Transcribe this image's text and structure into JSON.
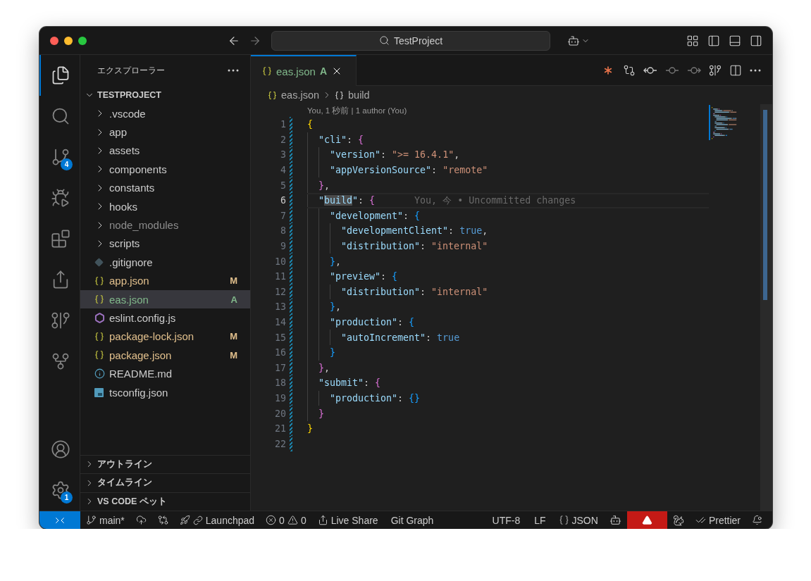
{
  "title_bar": {
    "search": "TestProject"
  },
  "activity_bar": {
    "top": [
      {
        "kind": "files",
        "selected": true
      },
      {
        "kind": "search",
        "selected": false
      },
      {
        "kind": "source-control",
        "selected": false,
        "badge": "4"
      },
      {
        "kind": "run-debug",
        "selected": false
      },
      {
        "kind": "extensions",
        "selected": false
      },
      {
        "kind": "live-share",
        "selected": false
      },
      {
        "kind": "git-graph",
        "selected": false
      },
      {
        "kind": "git-remote",
        "selected": false
      }
    ],
    "bottom": [
      {
        "kind": "account",
        "selected": false
      },
      {
        "kind": "settings",
        "selected": false,
        "badge": "1"
      }
    ]
  },
  "sidebar": {
    "title": "エクスプローラー",
    "root": {
      "label": "TESTPROJECT",
      "expanded": true
    },
    "items": [
      {
        "kind": "folder",
        "label": ".vscode",
        "expanded": false,
        "selected": false,
        "color": "#cccccc"
      },
      {
        "kind": "folder",
        "label": "app",
        "expanded": false,
        "selected": false,
        "color": "#cccccc"
      },
      {
        "kind": "folder",
        "label": "assets",
        "expanded": false,
        "selected": false,
        "color": "#cccccc"
      },
      {
        "kind": "folder",
        "label": "components",
        "expanded": false,
        "selected": false,
        "color": "#cccccc"
      },
      {
        "kind": "folder",
        "label": "constants",
        "expanded": false,
        "selected": false,
        "color": "#cccccc"
      },
      {
        "kind": "folder",
        "label": "hooks",
        "expanded": false,
        "selected": false,
        "color": "#cccccc"
      },
      {
        "kind": "folder",
        "label": "node_modules",
        "expanded": false,
        "selected": false,
        "color": "#8c8c8c"
      },
      {
        "kind": "folder",
        "label": "scripts",
        "expanded": false,
        "selected": false,
        "color": "#cccccc"
      },
      {
        "kind": "git",
        "label": ".gitignore",
        "selected": false,
        "color": "#cccccc"
      },
      {
        "kind": "json",
        "label": "app.json",
        "selected": false,
        "color": "#e2c08d",
        "badge": "M"
      },
      {
        "kind": "json",
        "label": "eas.json",
        "selected": true,
        "color": "#81b88b",
        "badge": "A"
      },
      {
        "kind": "eslint",
        "label": "eslint.config.js",
        "selected": false,
        "color": "#cccccc"
      },
      {
        "kind": "json",
        "label": "package-lock.json",
        "selected": false,
        "color": "#e2c08d",
        "badge": "M"
      },
      {
        "kind": "json",
        "label": "package.json",
        "selected": false,
        "color": "#e2c08d",
        "badge": "M"
      },
      {
        "kind": "info",
        "label": "README.md",
        "selected": false,
        "color": "#cccccc"
      },
      {
        "kind": "ts",
        "label": "tsconfig.json",
        "selected": false,
        "color": "#cccccc"
      }
    ],
    "sections": [
      {
        "label": "アウトライン",
        "expanded": false
      },
      {
        "label": "タイムライン",
        "expanded": false
      },
      {
        "label": "VS CODE ペット",
        "expanded": false
      }
    ]
  },
  "editor": {
    "tabs": [
      {
        "label": "eas.json",
        "status": "A",
        "selected": true
      }
    ],
    "breadcrumb": [
      "eas.json",
      "build"
    ],
    "codelens": "You, 1 秒前 | 1 author (You)",
    "lines": [
      {
        "number": "1",
        "added": true,
        "current": false,
        "tokens": [
          {
            "kind": "b1",
            "text": "{"
          }
        ]
      },
      {
        "number": "2",
        "added": true,
        "current": false,
        "tokens": [
          {
            "kind": "key",
            "text": "  \"cli\""
          },
          {
            "kind": "punct",
            "text": ": "
          },
          {
            "kind": "b2",
            "text": "{"
          }
        ]
      },
      {
        "number": "3",
        "added": true,
        "current": false,
        "tokens": [
          {
            "kind": "key",
            "text": "    \"version\""
          },
          {
            "kind": "punct",
            "text": ": "
          },
          {
            "kind": "str",
            "text": "\">= 16.4.1\""
          },
          {
            "kind": "punct",
            "text": ","
          }
        ]
      },
      {
        "number": "4",
        "added": true,
        "current": false,
        "tokens": [
          {
            "kind": "key",
            "text": "    \"appVersionSource\""
          },
          {
            "kind": "punct",
            "text": ": "
          },
          {
            "kind": "str",
            "text": "\"remote\""
          }
        ]
      },
      {
        "number": "5",
        "added": true,
        "current": false,
        "tokens": [
          {
            "kind": "b2",
            "text": "  }"
          },
          {
            "kind": "punct",
            "text": ","
          }
        ]
      },
      {
        "number": "6",
        "added": true,
        "current": true,
        "blame": "You, 今 • Uncommitted changes",
        "tokens": [
          {
            "kind": "key",
            "text": "  \""
          },
          {
            "kind": "key_match",
            "text": "build"
          },
          {
            "kind": "key",
            "text": "\""
          },
          {
            "kind": "punct",
            "text": ": "
          },
          {
            "kind": "b2",
            "text": "{"
          }
        ]
      },
      {
        "number": "7",
        "added": true,
        "current": false,
        "tokens": [
          {
            "kind": "key",
            "text": "    \"development\""
          },
          {
            "kind": "punct",
            "text": ": "
          },
          {
            "kind": "b3",
            "text": "{"
          }
        ]
      },
      {
        "number": "8",
        "added": true,
        "current": false,
        "tokens": [
          {
            "kind": "key",
            "text": "      \"developmentClient\""
          },
          {
            "kind": "punct",
            "text": ": "
          },
          {
            "kind": "bool",
            "text": "true"
          },
          {
            "kind": "punct",
            "text": ","
          }
        ]
      },
      {
        "number": "9",
        "added": true,
        "current": false,
        "tokens": [
          {
            "kind": "key",
            "text": "      \"distribution\""
          },
          {
            "kind": "punct",
            "text": ": "
          },
          {
            "kind": "str",
            "text": "\"internal\""
          }
        ]
      },
      {
        "number": "10",
        "added": true,
        "current": false,
        "tokens": [
          {
            "kind": "b3",
            "text": "    }"
          },
          {
            "kind": "punct",
            "text": ","
          }
        ]
      },
      {
        "number": "11",
        "added": true,
        "current": false,
        "tokens": [
          {
            "kind": "key",
            "text": "    \"preview\""
          },
          {
            "kind": "punct",
            "text": ": "
          },
          {
            "kind": "b3",
            "text": "{"
          }
        ]
      },
      {
        "number": "12",
        "added": true,
        "current": false,
        "tokens": [
          {
            "kind": "key",
            "text": "      \"distribution\""
          },
          {
            "kind": "punct",
            "text": ": "
          },
          {
            "kind": "str",
            "text": "\"internal\""
          }
        ]
      },
      {
        "number": "13",
        "added": true,
        "current": false,
        "tokens": [
          {
            "kind": "b3",
            "text": "    }"
          },
          {
            "kind": "punct",
            "text": ","
          }
        ]
      },
      {
        "number": "14",
        "added": true,
        "current": false,
        "tokens": [
          {
            "kind": "key",
            "text": "    \"production\""
          },
          {
            "kind": "punct",
            "text": ": "
          },
          {
            "kind": "b3",
            "text": "{"
          }
        ]
      },
      {
        "number": "15",
        "added": true,
        "current": false,
        "tokens": [
          {
            "kind": "key",
            "text": "      \"autoIncrement\""
          },
          {
            "kind": "punct",
            "text": ": "
          },
          {
            "kind": "bool",
            "text": "true"
          }
        ]
      },
      {
        "number": "16",
        "added": true,
        "current": false,
        "tokens": [
          {
            "kind": "b3",
            "text": "    }"
          }
        ]
      },
      {
        "number": "17",
        "added": true,
        "current": false,
        "tokens": [
          {
            "kind": "b2",
            "text": "  }"
          },
          {
            "kind": "punct",
            "text": ","
          }
        ]
      },
      {
        "number": "18",
        "added": true,
        "current": false,
        "tokens": [
          {
            "kind": "key",
            "text": "  \"submit\""
          },
          {
            "kind": "punct",
            "text": ": "
          },
          {
            "kind": "b2",
            "text": "{"
          }
        ]
      },
      {
        "number": "19",
        "added": true,
        "current": false,
        "tokens": [
          {
            "kind": "key",
            "text": "    \"production\""
          },
          {
            "kind": "punct",
            "text": ": "
          },
          {
            "kind": "b3",
            "text": "{}"
          }
        ]
      },
      {
        "number": "20",
        "added": true,
        "current": false,
        "tokens": [
          {
            "kind": "b2",
            "text": "  }"
          }
        ]
      },
      {
        "number": "21",
        "added": true,
        "current": false,
        "tokens": [
          {
            "kind": "b1",
            "text": "}"
          }
        ]
      },
      {
        "number": "22",
        "added": true,
        "current": false
      }
    ]
  },
  "status_bar": {
    "left": [
      {
        "kind": "remote"
      },
      {
        "kind": "branch",
        "text": "main*"
      },
      {
        "kind": "publish"
      },
      {
        "kind": "compare"
      },
      {
        "kind": "launchpad",
        "text": "Launchpad"
      },
      {
        "kind": "problems",
        "errors": "0",
        "warnings": "0"
      },
      {
        "kind": "live-share",
        "text": "Live Share"
      },
      {
        "kind": "text",
        "text": "Git Graph"
      }
    ],
    "right": [
      {
        "kind": "text",
        "text": "UTF-8"
      },
      {
        "kind": "text",
        "text": "LF"
      },
      {
        "kind": "language",
        "text": "JSON"
      },
      {
        "kind": "copilot"
      },
      {
        "kind": "alert"
      },
      {
        "kind": "squirrel"
      },
      {
        "kind": "prettier",
        "text": "Prettier"
      },
      {
        "kind": "bell"
      }
    ]
  }
}
